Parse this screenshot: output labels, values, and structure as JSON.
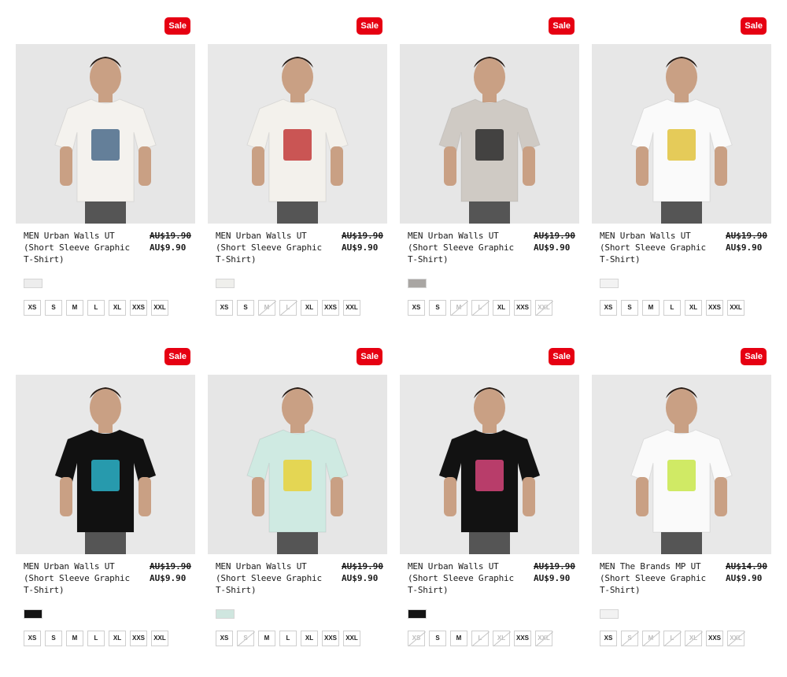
{
  "products": [
    {
      "badge": "Sale",
      "name": "MEN Urban Walls UT (Short Sleeve Graphic T-Shirt)",
      "original_price": "AU$19.90",
      "sale_price": "AU$9.90",
      "swatch_color": "#ededed",
      "shirt_color": "#f4f2ee",
      "graphic_color": "#4a6b8a",
      "bg_color": "#e6e6e6",
      "sizes": [
        {
          "label": "XS",
          "available": true
        },
        {
          "label": "S",
          "available": true
        },
        {
          "label": "M",
          "available": true
        },
        {
          "label": "L",
          "available": true
        },
        {
          "label": "XL",
          "available": true
        },
        {
          "label": "XXS",
          "available": true
        },
        {
          "label": "XXL",
          "available": true
        }
      ]
    },
    {
      "badge": "Sale",
      "name": "MEN Urban Walls UT (Short Sleeve Graphic T-Shirt)",
      "original_price": "AU$19.90",
      "sale_price": "AU$9.90",
      "swatch_color": "#efefec",
      "shirt_color": "#f3f1ec",
      "graphic_color": "#c23a3a",
      "bg_color": "#e8e8e8",
      "sizes": [
        {
          "label": "XS",
          "available": true
        },
        {
          "label": "S",
          "available": true
        },
        {
          "label": "M",
          "available": false
        },
        {
          "label": "L",
          "available": false
        },
        {
          "label": "XL",
          "available": true
        },
        {
          "label": "XXS",
          "available": true
        },
        {
          "label": "XXL",
          "available": true
        }
      ]
    },
    {
      "badge": "Sale",
      "name": "MEN Urban Walls UT (Short Sleeve Graphic T-Shirt)",
      "original_price": "AU$19.90",
      "sale_price": "AU$9.90",
      "swatch_color": "#a9a6a3",
      "shirt_color": "#cfcac4",
      "graphic_color": "#2a2a2a",
      "bg_color": "#e6e6e6",
      "sizes": [
        {
          "label": "XS",
          "available": true
        },
        {
          "label": "S",
          "available": true
        },
        {
          "label": "M",
          "available": false
        },
        {
          "label": "L",
          "available": false
        },
        {
          "label": "XL",
          "available": true
        },
        {
          "label": "XXS",
          "available": true
        },
        {
          "label": "XXL",
          "available": false
        }
      ]
    },
    {
      "badge": "Sale",
      "name": "MEN Urban Walls UT (Short Sleeve Graphic T-Shirt)",
      "original_price": "AU$19.90",
      "sale_price": "AU$9.90",
      "swatch_color": "#f2f2f2",
      "shirt_color": "#fafafa",
      "graphic_color": "#e0c23c",
      "bg_color": "#e7e7e7",
      "sizes": [
        {
          "label": "XS",
          "available": true
        },
        {
          "label": "S",
          "available": true
        },
        {
          "label": "M",
          "available": true
        },
        {
          "label": "L",
          "available": true
        },
        {
          "label": "XL",
          "available": true
        },
        {
          "label": "XXS",
          "available": true
        },
        {
          "label": "XXL",
          "available": true
        }
      ]
    },
    {
      "badge": "Sale",
      "name": "MEN Urban Walls UT (Short Sleeve Graphic T-Shirt)",
      "original_price": "AU$19.90",
      "sale_price": "AU$9.90",
      "swatch_color": "#141414",
      "shirt_color": "#111111",
      "graphic_color": "#2bb3c9",
      "bg_color": "#e8e8e8",
      "sizes": [
        {
          "label": "XS",
          "available": true
        },
        {
          "label": "S",
          "available": true
        },
        {
          "label": "M",
          "available": true
        },
        {
          "label": "L",
          "available": true
        },
        {
          "label": "XL",
          "available": true
        },
        {
          "label": "XXS",
          "available": true
        },
        {
          "label": "XXL",
          "available": true
        }
      ]
    },
    {
      "badge": "Sale",
      "name": "MEN Urban Walls UT (Short Sleeve Graphic T-Shirt)",
      "original_price": "AU$19.90",
      "sale_price": "AU$9.90",
      "swatch_color": "#cfe6df",
      "shirt_color": "#cfeae2",
      "graphic_color": "#e8d23a",
      "bg_color": "#e6e6e6",
      "sizes": [
        {
          "label": "XS",
          "available": true
        },
        {
          "label": "S",
          "available": false
        },
        {
          "label": "M",
          "available": true
        },
        {
          "label": "L",
          "available": true
        },
        {
          "label": "XL",
          "available": true
        },
        {
          "label": "XXS",
          "available": true
        },
        {
          "label": "XXL",
          "available": true
        }
      ]
    },
    {
      "badge": "Sale",
      "name": "MEN Urban Walls UT (Short Sleeve Graphic T-Shirt)",
      "original_price": "AU$19.90",
      "sale_price": "AU$9.90",
      "swatch_color": "#141414",
      "shirt_color": "#121212",
      "graphic_color": "#d6457a",
      "bg_color": "#e8e8e8",
      "sizes": [
        {
          "label": "XS",
          "available": false
        },
        {
          "label": "S",
          "available": true
        },
        {
          "label": "M",
          "available": true
        },
        {
          "label": "L",
          "available": false
        },
        {
          "label": "XL",
          "available": false
        },
        {
          "label": "XXS",
          "available": true
        },
        {
          "label": "XXL",
          "available": false
        }
      ]
    },
    {
      "badge": "Sale",
      "name": "MEN The Brands MP UT (Short Sleeve Graphic T-Shirt)",
      "original_price": "AU$14.90",
      "sale_price": "AU$9.90",
      "swatch_color": "#f2f2f2",
      "shirt_color": "#fafafa",
      "graphic_color": "#c8e64a",
      "bg_color": "#e8e8e8",
      "sizes": [
        {
          "label": "XS",
          "available": true
        },
        {
          "label": "S",
          "available": false
        },
        {
          "label": "M",
          "available": false
        },
        {
          "label": "L",
          "available": false
        },
        {
          "label": "XL",
          "available": false
        },
        {
          "label": "XXS",
          "available": true
        },
        {
          "label": "XXL",
          "available": false
        }
      ]
    }
  ]
}
